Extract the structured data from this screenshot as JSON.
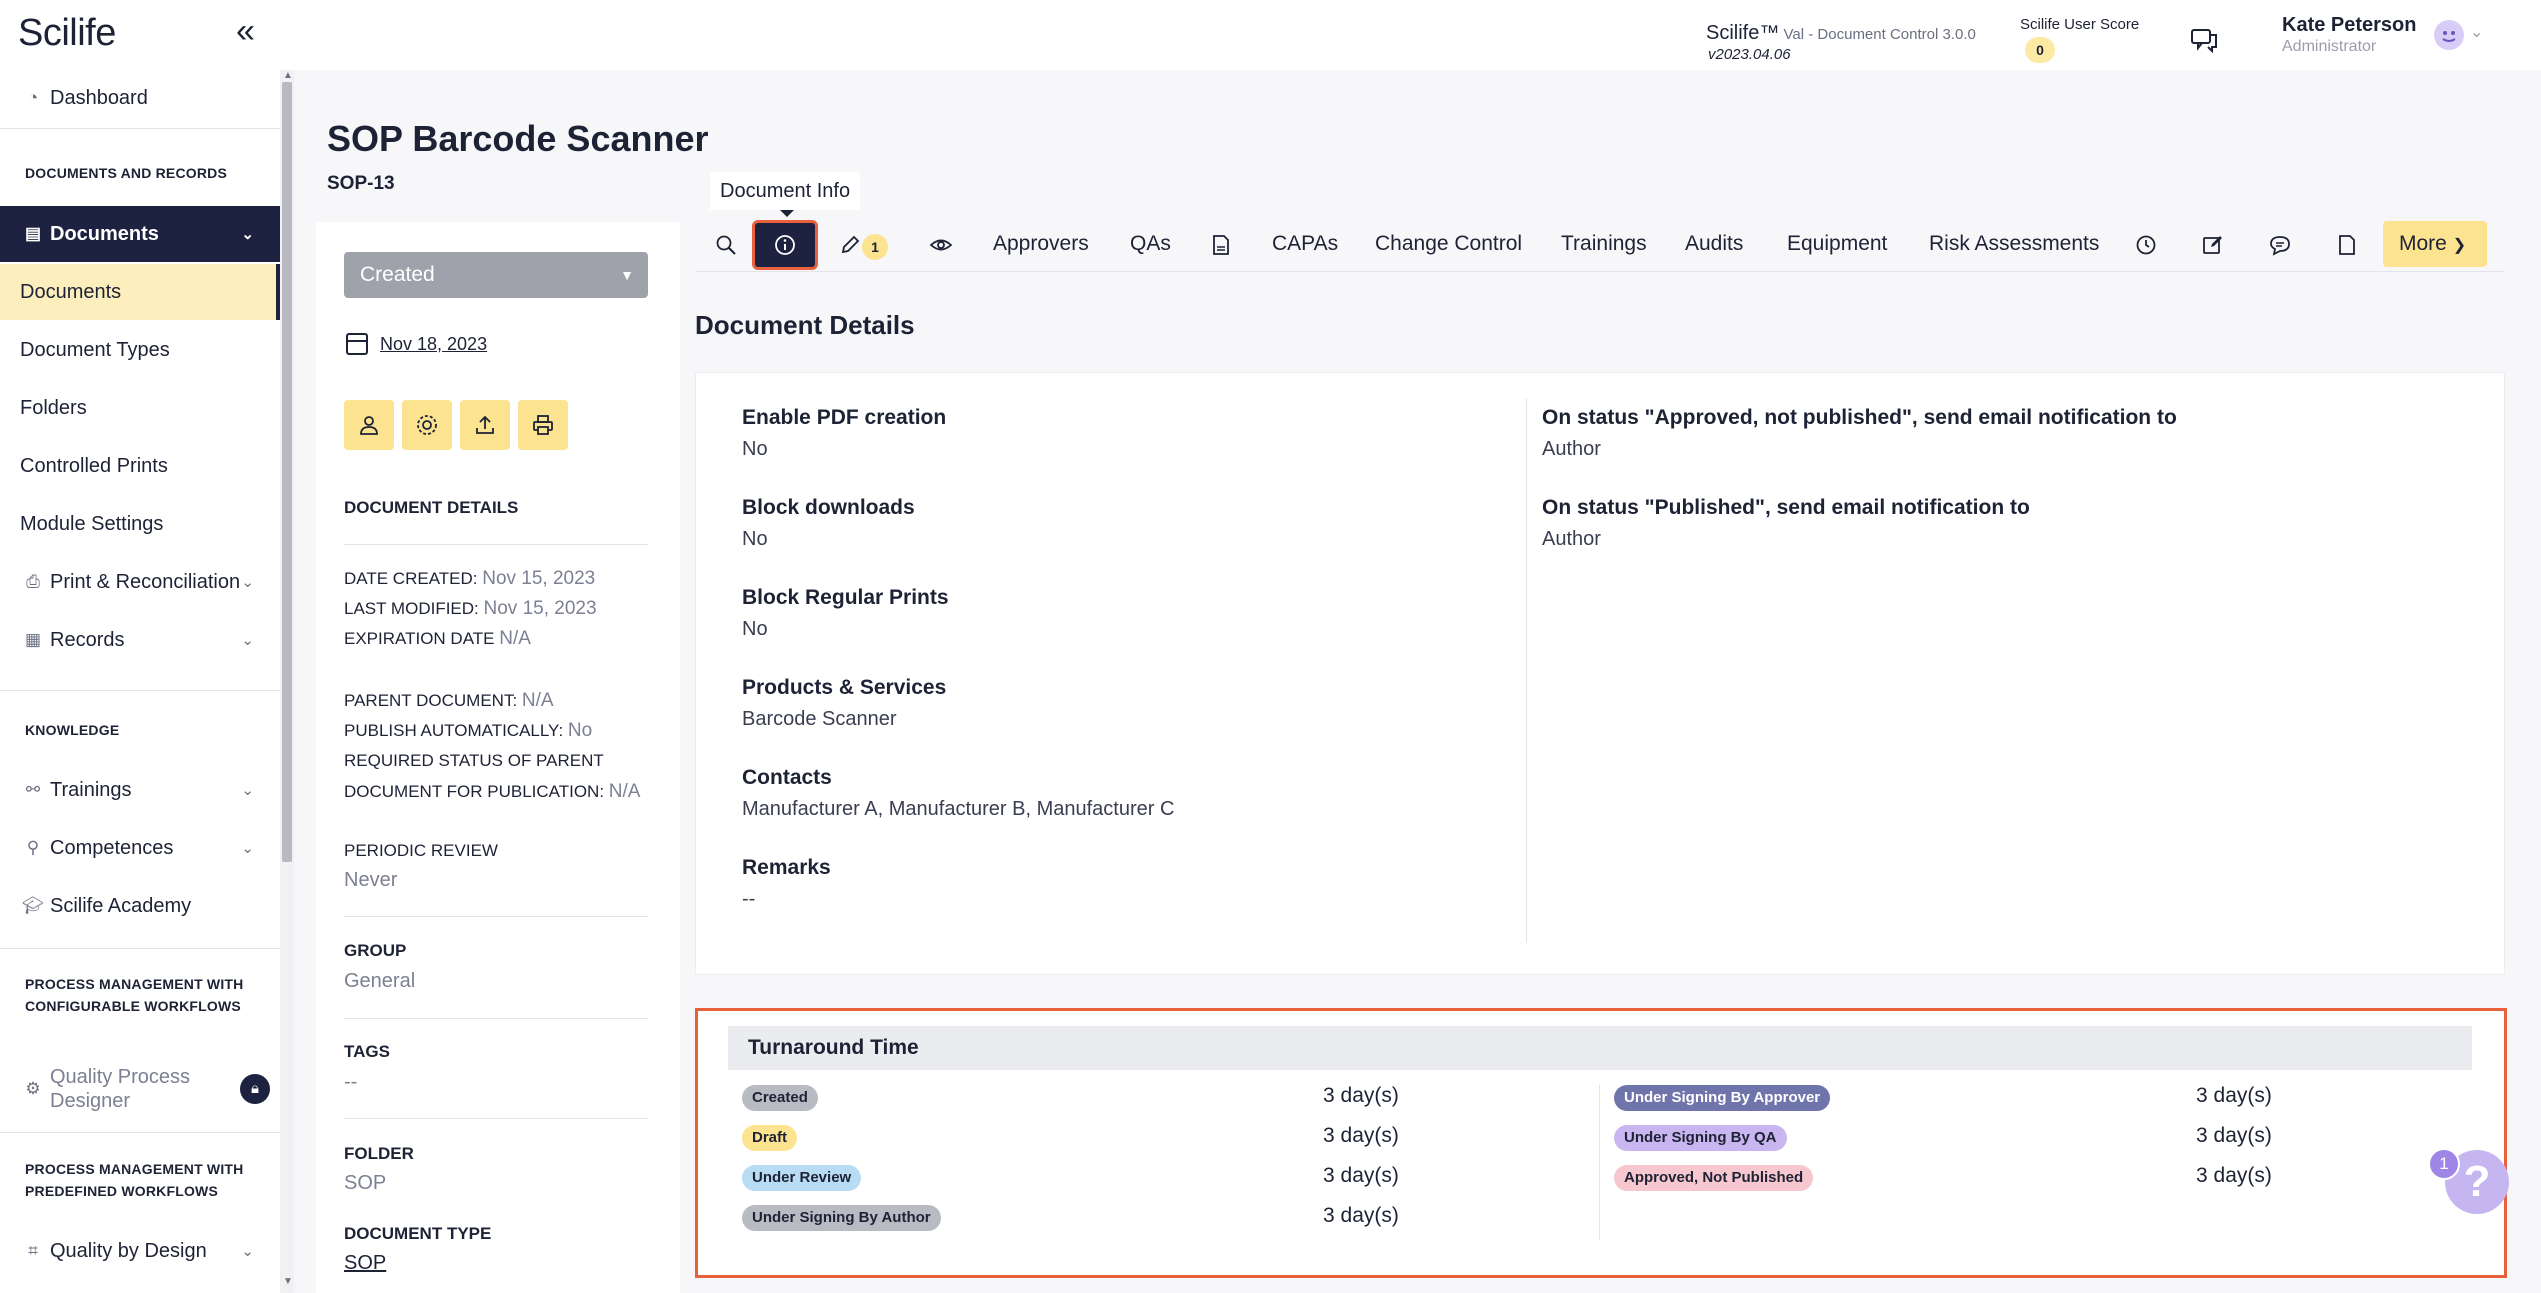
{
  "header": {
    "logo": "Scilife",
    "collapse_glyph": "«",
    "app_name": "Scilife™",
    "app_module": " Val - Document Control 3.0.0",
    "app_version": "v2023.04.06",
    "score_label": "Scilife User Score",
    "score_value": "0",
    "user_name": "Kate Peterson",
    "user_role": "Administrator"
  },
  "sidebar": {
    "dashboard": "Dashboard",
    "section_docs": "DOCUMENTS AND RECORDS",
    "documents": "Documents",
    "sub_documents": "Documents",
    "document_types": "Document Types",
    "folders": "Folders",
    "controlled_prints": "Controlled Prints",
    "module_settings": "Module Settings",
    "print_reconciliation": "Print & Reconciliation",
    "records": "Records",
    "section_knowledge": "KNOWLEDGE",
    "trainings": "Trainings",
    "competences": "Competences",
    "academy": "Scilife Academy",
    "section_configurable_1": "PROCESS MANAGEMENT WITH",
    "section_configurable_2": "CONFIGURABLE WORKFLOWS",
    "quality_process_designer_1": "Quality Process",
    "quality_process_designer_2": "Designer",
    "section_predefined_1": "PROCESS MANAGEMENT WITH",
    "section_predefined_2": "PREDEFINED WORKFLOWS",
    "quality_by_design": "Quality by Design"
  },
  "document": {
    "title": "SOP Barcode Scanner",
    "code": "SOP-13"
  },
  "panel": {
    "status": "Created",
    "date": "Nov 18, 2023",
    "details_heading": "DOCUMENT DETAILS",
    "date_created_label": "DATE CREATED: ",
    "date_created": "Nov 15, 2023",
    "last_modified_label": "LAST MODIFIED: ",
    "last_modified": "Nov 15, 2023",
    "expiration_label": "EXPIRATION DATE ",
    "expiration": "N/A",
    "parent_label": "PARENT DOCUMENT: ",
    "parent": "N/A",
    "publish_auto_label": "PUBLISH AUTOMATICALLY: ",
    "publish_auto": "No",
    "required_status_label_1": "REQUIRED STATUS OF PARENT",
    "required_status_label_2": "DOCUMENT FOR PUBLICATION: ",
    "required_status": "N/A",
    "periodic_review_label": "PERIODIC REVIEW",
    "periodic_review": "Never",
    "group_label": "GROUP",
    "group": "General",
    "tags_label": "TAGS",
    "tags": "--",
    "folder_label": "FOLDER",
    "folder": "SOP",
    "doc_type_label": "DOCUMENT TYPE",
    "doc_type": "SOP"
  },
  "tabs": {
    "tooltip": "Document Info",
    "edit_badge": "1",
    "approvers": "Approvers",
    "qas": "QAs",
    "capas": "CAPAs",
    "change_control": "Change Control",
    "trainings": "Trainings",
    "audits": "Audits",
    "equipment": "Equipment",
    "risk_assessments": "Risk Assessments",
    "more": "More"
  },
  "details": {
    "title": "Document Details",
    "pdf_label": "Enable PDF creation",
    "pdf_value": "No",
    "block_downloads_label": "Block downloads",
    "block_downloads_value": "No",
    "block_prints_label": "Block Regular Prints",
    "block_prints_value": "No",
    "products_label": "Products & Services",
    "products_value": "Barcode Scanner",
    "contacts_label": "Contacts",
    "contacts_value": "Manufacturer A, Manufacturer B, Manufacturer C",
    "remarks_label": "Remarks",
    "remarks_value": "--",
    "notify_approved_label": "On status \"Approved, not published\", send email notification to",
    "notify_approved_value": "Author",
    "notify_published_label": "On status \"Published\", send email notification to",
    "notify_published_value": "Author"
  },
  "turnaround": {
    "title": "Turnaround Time",
    "rows": [
      {
        "status": "Created",
        "days": "3 day(s)",
        "bg": "#b9bbc3",
        "fg": "#1e2235"
      },
      {
        "status": "Draft",
        "days": "3 day(s)",
        "bg": "#fce38f",
        "fg": "#1e2235"
      },
      {
        "status": "Under Review",
        "days": "3 day(s)",
        "bg": "#b9dcf5",
        "fg": "#1e2235"
      },
      {
        "status": "Under Signing By Author",
        "days": "3 day(s)",
        "bg": "#b9bbc3",
        "fg": "#1e2235"
      },
      {
        "status": "Under Signing By Approver",
        "days": "3 day(s)",
        "bg": "#6f74ab",
        "fg": "#ffffff"
      },
      {
        "status": "Under Signing By QA",
        "days": "3 day(s)",
        "bg": "#c9b6f0",
        "fg": "#1e2235"
      },
      {
        "status": "Approved, Not Published",
        "days": "3 day(s)",
        "bg": "#f6c7cf",
        "fg": "#1e2235"
      }
    ]
  },
  "help": {
    "glyph": "?",
    "badge": "1"
  },
  "colors": {
    "navy": "#1d2240",
    "accent_yellow": "#fce38f",
    "highlight_orange": "#e8603c"
  }
}
